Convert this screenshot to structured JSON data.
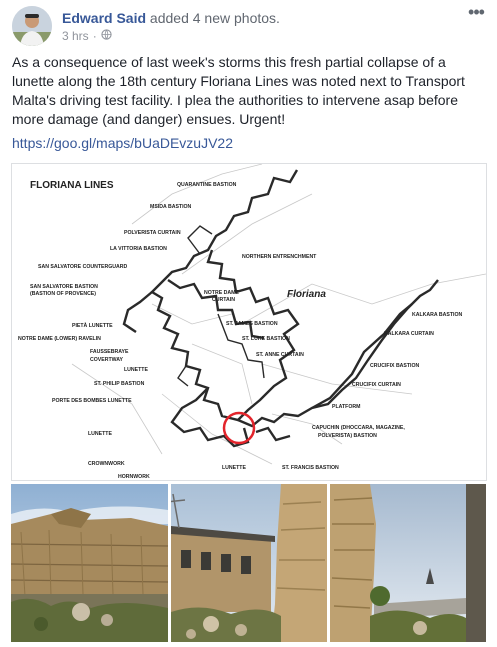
{
  "post": {
    "author": "Edward Said",
    "action": "added 4 new photos.",
    "time": "3 hrs",
    "separator": "·",
    "audience_icon": "globe-icon",
    "more_icon": "more-options-icon",
    "text": "As a consequence of last week's storms this fresh partial collapse of a lunette along the 18th century Floriana Lines was noted next to Transport Malta's driving test facility. I plea the authorities to intervene asap before more damage (and danger) ensues. Urgent!",
    "link": "https://goo.gl/maps/bUaDEvzuJV22"
  },
  "map": {
    "title": "FLORIANA LINES",
    "city": "Floriana",
    "labels": {
      "quarantine": "QUARANTINE BASTION",
      "msida": "MSIDA BASTION",
      "polverista": "POLVERISTA CURTAIN",
      "vittoria": "LA VITTORIA BASTION",
      "ssc": "SAN SALVATORE COUNTERGUARD",
      "ssb1": "SAN SALVATORE BASTION",
      "ssb2": "(BASTION OF PROVENCE)",
      "pieta": "PIETÀ LUNETTE",
      "ndr": "NOTRE DAME (LOWER) RAVELIN",
      "fausse": "FAUSSEBRAYE",
      "coverway": "COVERTWAY",
      "lunette_a": "LUNETTE",
      "stphilip": "ST. PHILIP BASTION",
      "porte": "PORTE DES BOMBES LUNETTE",
      "lunette_b": "LUNETTE",
      "crownwork": "CROWNWORK",
      "hornwork": "HORNWORK",
      "northern": "NORTHERN ENTRENCHMENT",
      "ndc1": "NOTRE DAME",
      "ndc2": "CURTAIN",
      "stjames": "ST. JAMES BASTION",
      "stluke": "ST. LUKE BASTION",
      "stanne": "ST. ANNE CURTAIN",
      "kalkarab": "KALKARA BASTION",
      "kalkarac": "KALKARA CURTAIN",
      "crucifixb": "CRUCIFIX BASTION",
      "crucifixc": "CRUCIFIX CURTAIN",
      "platform": "PLATFORM",
      "capuchin1": "CAPUCHIN (DHOCCARA, MAGAZINE,",
      "capuchin2": "POLVERISTA) BASTION",
      "lunette_c": "LUNETTE",
      "stfrancis": "ST. FRANCIS BASTION"
    },
    "highlight_color": "#e3242b"
  },
  "photos": [
    {
      "name": "collapsed-lunette-wall-photo"
    },
    {
      "name": "building-and-rubble-photo"
    },
    {
      "name": "collapsed-stone-column-photo"
    }
  ]
}
